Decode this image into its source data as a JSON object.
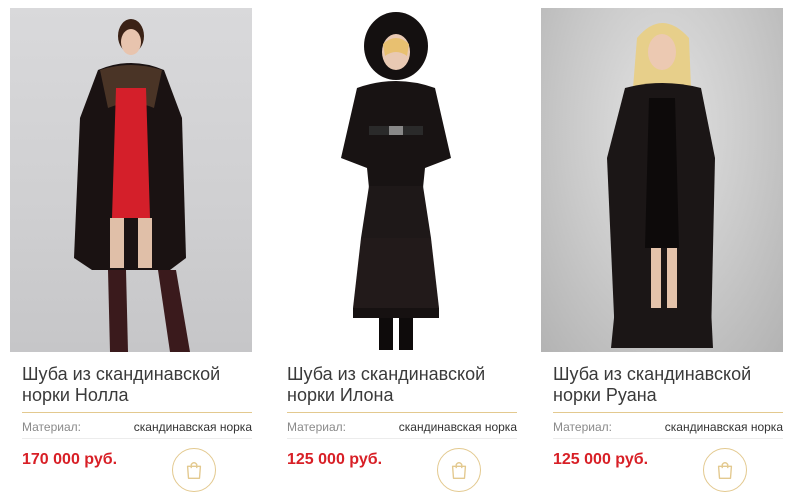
{
  "products": [
    {
      "title": "Шуба из скандинавской норки Нолла",
      "material_label": "Материал:",
      "material_value": "скандинавская норка",
      "price": "170 000 руб.",
      "cart_icon": "shopping-bag-icon"
    },
    {
      "title": "Шуба из скандинавской норки Илона",
      "material_label": "Материал:",
      "material_value": "скандинавская норка",
      "price": "125 000 руб.",
      "cart_icon": "shopping-bag-icon"
    },
    {
      "title": "Шуба из скандинавской норки Руана",
      "material_label": "Материал:",
      "material_value": "скандинавская норка",
      "price": "125 000 руб.",
      "cart_icon": "shopping-bag-icon"
    }
  ],
  "colors": {
    "price": "#d81f26",
    "accent_gold": "#e3c98f",
    "title_text": "#3a3a3a"
  }
}
